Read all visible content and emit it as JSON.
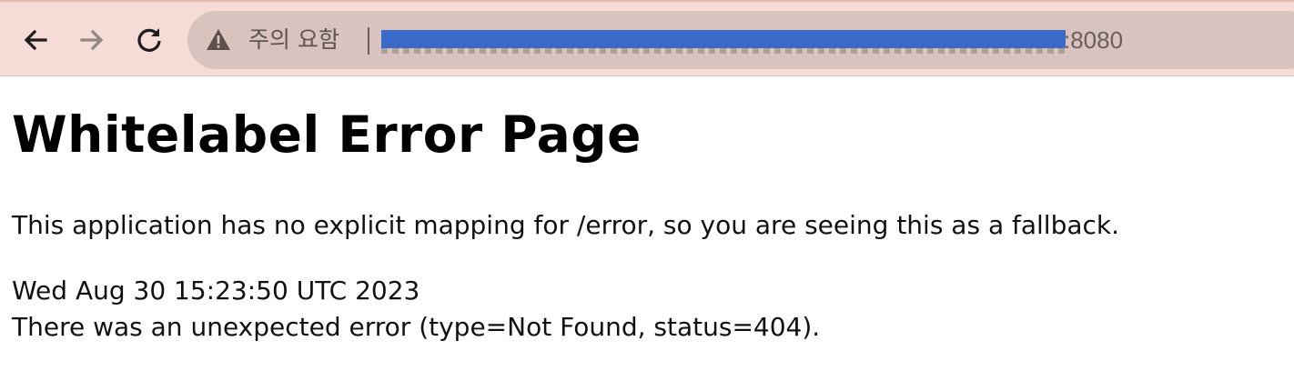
{
  "browser": {
    "security_label": "주의 요함",
    "url_visible_suffix": ":8080",
    "colors": {
      "toolbar_bg": "#f6dcd6",
      "omnibox_bg": "#d9c3be",
      "redaction": "#3a6bc8"
    },
    "icons": {
      "back": "arrow-left-icon",
      "forward": "arrow-right-icon",
      "reload": "reload-icon",
      "security": "warning-triangle-icon"
    }
  },
  "page": {
    "title": "Whitelabel Error Page",
    "explanation": "This application has no explicit mapping for /error, so you are seeing this as a fallback.",
    "timestamp": "Wed Aug 30 15:23:50 UTC 2023",
    "error_detail": "There was an unexpected error (type=Not Found, status=404)."
  }
}
